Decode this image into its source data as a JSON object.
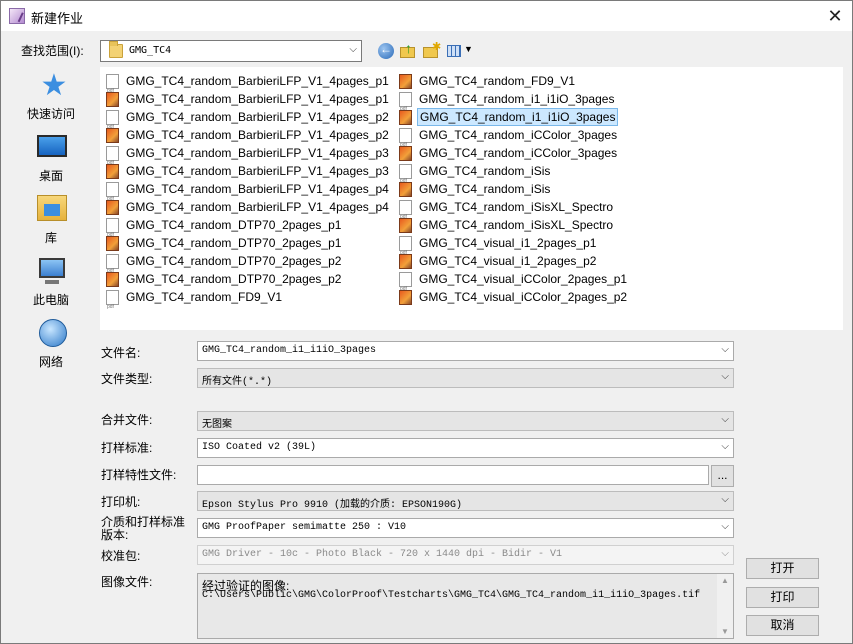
{
  "window": {
    "title": "新建作业",
    "close_glyph": "✕"
  },
  "lookin": {
    "label": "查找范围(I):",
    "value": "GMG_TC4"
  },
  "toolbar": {
    "back": "back-icon",
    "up": "up-folder-icon",
    "new_folder": "new-folder-icon",
    "view": "view-menu-icon"
  },
  "places": [
    {
      "label": "快速访问",
      "icon": "star-icon"
    },
    {
      "label": "桌面",
      "icon": "desktop-icon"
    },
    {
      "label": "库",
      "icon": "library-icon"
    },
    {
      "label": "此电脑",
      "icon": "computer-icon"
    },
    {
      "label": "网络",
      "icon": "network-icon"
    }
  ],
  "files_col1": [
    {
      "name": "GMG_TC4_random_BarbieriLFP_V1_4pages_p1",
      "type": "pdf"
    },
    {
      "name": "GMG_TC4_random_BarbieriLFP_V1_4pages_p1",
      "type": "img"
    },
    {
      "name": "GMG_TC4_random_BarbieriLFP_V1_4pages_p2",
      "type": "pdf"
    },
    {
      "name": "GMG_TC4_random_BarbieriLFP_V1_4pages_p2",
      "type": "img"
    },
    {
      "name": "GMG_TC4_random_BarbieriLFP_V1_4pages_p3",
      "type": "pdf"
    },
    {
      "name": "GMG_TC4_random_BarbieriLFP_V1_4pages_p3",
      "type": "img"
    },
    {
      "name": "GMG_TC4_random_BarbieriLFP_V1_4pages_p4",
      "type": "pdf"
    },
    {
      "name": "GMG_TC4_random_BarbieriLFP_V1_4pages_p4",
      "type": "img"
    },
    {
      "name": "GMG_TC4_random_DTP70_2pages_p1",
      "type": "pdf"
    },
    {
      "name": "GMG_TC4_random_DTP70_2pages_p1",
      "type": "img"
    },
    {
      "name": "GMG_TC4_random_DTP70_2pages_p2",
      "type": "pdf"
    },
    {
      "name": "GMG_TC4_random_DTP70_2pages_p2",
      "type": "img"
    },
    {
      "name": "GMG_TC4_random_FD9_V1",
      "type": "pdf"
    }
  ],
  "files_col2": [
    {
      "name": "GMG_TC4_random_FD9_V1",
      "type": "img"
    },
    {
      "name": "GMG_TC4_random_i1_i1iO_3pages",
      "type": "pdf"
    },
    {
      "name": "GMG_TC4_random_i1_i1iO_3pages",
      "type": "img",
      "selected": true
    },
    {
      "name": "GMG_TC4_random_iCColor_3pages",
      "type": "pdf"
    },
    {
      "name": "GMG_TC4_random_iCColor_3pages",
      "type": "img"
    },
    {
      "name": "GMG_TC4_random_iSis",
      "type": "pdf"
    },
    {
      "name": "GMG_TC4_random_iSis",
      "type": "img"
    },
    {
      "name": "GMG_TC4_random_iSisXL_Spectro",
      "type": "pdf"
    },
    {
      "name": "GMG_TC4_random_iSisXL_Spectro",
      "type": "img"
    },
    {
      "name": "GMG_TC4_visual_i1_2pages_p1",
      "type": "pdf"
    },
    {
      "name": "GMG_TC4_visual_i1_2pages_p2",
      "type": "img"
    },
    {
      "name": "GMG_TC4_visual_iCColor_2pages_p1",
      "type": "pdf"
    },
    {
      "name": "GMG_TC4_visual_iCColor_2pages_p2",
      "type": "img"
    }
  ],
  "form": {
    "filename_label": "文件名:",
    "filename_value": "GMG_TC4_random_i1_i1iO_3pages",
    "filetype_label": "文件类型:",
    "filetype_value": "所有文件(*.*)",
    "merge_label": "合并文件:",
    "merge_value": "无图案",
    "proof_std_label": "打样标准:",
    "proof_std_value": "ISO Coated v2 (39L)",
    "proof_char_label": "打样特性文件:",
    "proof_char_value": "",
    "browse_label": "...",
    "printer_label": "打印机:",
    "printer_value": "Epson Stylus Pro 9910 (加载的介质: EPSON190G)",
    "media_label_1": "介质和打样标准",
    "media_label_2": "版本:",
    "media_value": "GMG ProofPaper semimatte 250 : V10",
    "calib_label": "校准包:",
    "calib_value": "GMG Driver - 10c - Photo Black - 720 x 1440 dpi - Bidir - V1",
    "image_label": "图像文件:",
    "image_line1": "经过验证的图像:",
    "image_line2": "C:\\Users\\Public\\GMG\\ColorProof\\Testcharts\\GMG_TC4\\GMG_TC4_random_i1_i1iO_3pages.tif"
  },
  "buttons": {
    "open": "打开",
    "print": "打印",
    "cancel": "取消"
  },
  "colors": {
    "selection": "#cce8ff",
    "dialog_bg": "#f0f0f0"
  }
}
